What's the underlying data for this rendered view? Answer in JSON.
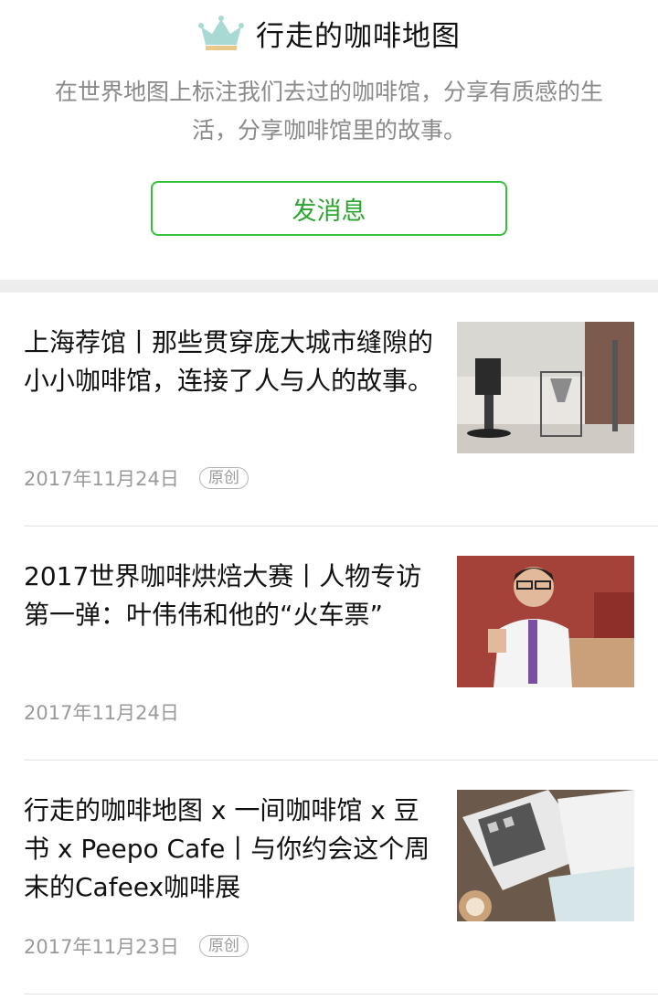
{
  "account": {
    "name": "行走的咖啡地图",
    "logo_icon": "crown-logo-icon",
    "description": "在世界地图上标注我们去过的咖啡馆，分享有质感的生活，分享咖啡馆里的故事。",
    "message_button": "发消息",
    "accent_color": "#35c13c"
  },
  "articles": [
    {
      "title": "上海荐馆丨那些贯穿庞大城市缝隙的小小咖啡馆，连接了人与人的故事。",
      "date": "2017年11月24日",
      "badge": "原创",
      "thumbnail_icon": "coffee-equipment-photo"
    },
    {
      "title": "2017世界咖啡烘焙大赛丨人物专访第一弹：叶伟伟和他的“火车票”",
      "date": "2017年11月24日",
      "badge": "",
      "thumbnail_icon": "person-thumbs-up-photo"
    },
    {
      "title": "行走的咖啡地图 x 一间咖啡馆 x 豆书 x Peepo Cafe丨与你约会这个周末的Cafeex咖啡展",
      "date": "2017年11月23日",
      "badge": "原创",
      "thumbnail_icon": "coffee-map-booklet-photo"
    }
  ]
}
